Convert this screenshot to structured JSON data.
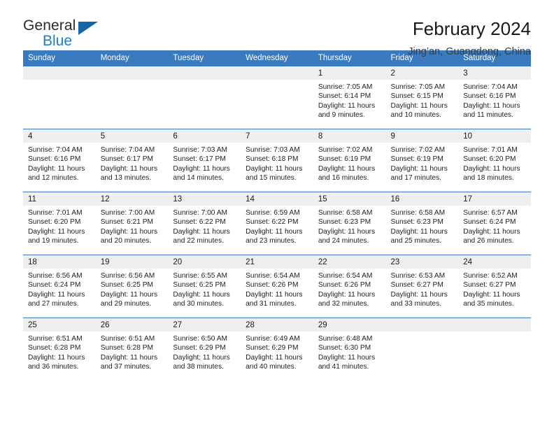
{
  "brand": {
    "name_part1": "General",
    "name_part2": "Blue",
    "triangle_color": "#1566a8",
    "blue_color": "#1d7ec6"
  },
  "header": {
    "title": "February 2024",
    "subtitle": "Jing’an, Guangdong, China",
    "header_bg": "#3a7bbf",
    "daynum_bg": "#efefef"
  },
  "weekdays": [
    "Sunday",
    "Monday",
    "Tuesday",
    "Wednesday",
    "Thursday",
    "Friday",
    "Saturday"
  ],
  "labels": {
    "sunrise": "Sunrise:",
    "sunset": "Sunset:",
    "daylight": "Daylight:"
  },
  "weeks": [
    [
      {
        "day": "",
        "sunrise": "",
        "sunset": "",
        "daylight_a": "",
        "daylight_b": ""
      },
      {
        "day": "",
        "sunrise": "",
        "sunset": "",
        "daylight_a": "",
        "daylight_b": ""
      },
      {
        "day": "",
        "sunrise": "",
        "sunset": "",
        "daylight_a": "",
        "daylight_b": ""
      },
      {
        "day": "",
        "sunrise": "",
        "sunset": "",
        "daylight_a": "",
        "daylight_b": ""
      },
      {
        "day": "1",
        "sunrise": "Sunrise: 7:05 AM",
        "sunset": "Sunset: 6:14 PM",
        "daylight_a": "Daylight: 11 hours",
        "daylight_b": "and 9 minutes."
      },
      {
        "day": "2",
        "sunrise": "Sunrise: 7:05 AM",
        "sunset": "Sunset: 6:15 PM",
        "daylight_a": "Daylight: 11 hours",
        "daylight_b": "and 10 minutes."
      },
      {
        "day": "3",
        "sunrise": "Sunrise: 7:04 AM",
        "sunset": "Sunset: 6:16 PM",
        "daylight_a": "Daylight: 11 hours",
        "daylight_b": "and 11 minutes."
      }
    ],
    [
      {
        "day": "4",
        "sunrise": "Sunrise: 7:04 AM",
        "sunset": "Sunset: 6:16 PM",
        "daylight_a": "Daylight: 11 hours",
        "daylight_b": "and 12 minutes."
      },
      {
        "day": "5",
        "sunrise": "Sunrise: 7:04 AM",
        "sunset": "Sunset: 6:17 PM",
        "daylight_a": "Daylight: 11 hours",
        "daylight_b": "and 13 minutes."
      },
      {
        "day": "6",
        "sunrise": "Sunrise: 7:03 AM",
        "sunset": "Sunset: 6:17 PM",
        "daylight_a": "Daylight: 11 hours",
        "daylight_b": "and 14 minutes."
      },
      {
        "day": "7",
        "sunrise": "Sunrise: 7:03 AM",
        "sunset": "Sunset: 6:18 PM",
        "daylight_a": "Daylight: 11 hours",
        "daylight_b": "and 15 minutes."
      },
      {
        "day": "8",
        "sunrise": "Sunrise: 7:02 AM",
        "sunset": "Sunset: 6:19 PM",
        "daylight_a": "Daylight: 11 hours",
        "daylight_b": "and 16 minutes."
      },
      {
        "day": "9",
        "sunrise": "Sunrise: 7:02 AM",
        "sunset": "Sunset: 6:19 PM",
        "daylight_a": "Daylight: 11 hours",
        "daylight_b": "and 17 minutes."
      },
      {
        "day": "10",
        "sunrise": "Sunrise: 7:01 AM",
        "sunset": "Sunset: 6:20 PM",
        "daylight_a": "Daylight: 11 hours",
        "daylight_b": "and 18 minutes."
      }
    ],
    [
      {
        "day": "11",
        "sunrise": "Sunrise: 7:01 AM",
        "sunset": "Sunset: 6:20 PM",
        "daylight_a": "Daylight: 11 hours",
        "daylight_b": "and 19 minutes."
      },
      {
        "day": "12",
        "sunrise": "Sunrise: 7:00 AM",
        "sunset": "Sunset: 6:21 PM",
        "daylight_a": "Daylight: 11 hours",
        "daylight_b": "and 20 minutes."
      },
      {
        "day": "13",
        "sunrise": "Sunrise: 7:00 AM",
        "sunset": "Sunset: 6:22 PM",
        "daylight_a": "Daylight: 11 hours",
        "daylight_b": "and 22 minutes."
      },
      {
        "day": "14",
        "sunrise": "Sunrise: 6:59 AM",
        "sunset": "Sunset: 6:22 PM",
        "daylight_a": "Daylight: 11 hours",
        "daylight_b": "and 23 minutes."
      },
      {
        "day": "15",
        "sunrise": "Sunrise: 6:58 AM",
        "sunset": "Sunset: 6:23 PM",
        "daylight_a": "Daylight: 11 hours",
        "daylight_b": "and 24 minutes."
      },
      {
        "day": "16",
        "sunrise": "Sunrise: 6:58 AM",
        "sunset": "Sunset: 6:23 PM",
        "daylight_a": "Daylight: 11 hours",
        "daylight_b": "and 25 minutes."
      },
      {
        "day": "17",
        "sunrise": "Sunrise: 6:57 AM",
        "sunset": "Sunset: 6:24 PM",
        "daylight_a": "Daylight: 11 hours",
        "daylight_b": "and 26 minutes."
      }
    ],
    [
      {
        "day": "18",
        "sunrise": "Sunrise: 6:56 AM",
        "sunset": "Sunset: 6:24 PM",
        "daylight_a": "Daylight: 11 hours",
        "daylight_b": "and 27 minutes."
      },
      {
        "day": "19",
        "sunrise": "Sunrise: 6:56 AM",
        "sunset": "Sunset: 6:25 PM",
        "daylight_a": "Daylight: 11 hours",
        "daylight_b": "and 29 minutes."
      },
      {
        "day": "20",
        "sunrise": "Sunrise: 6:55 AM",
        "sunset": "Sunset: 6:25 PM",
        "daylight_a": "Daylight: 11 hours",
        "daylight_b": "and 30 minutes."
      },
      {
        "day": "21",
        "sunrise": "Sunrise: 6:54 AM",
        "sunset": "Sunset: 6:26 PM",
        "daylight_a": "Daylight: 11 hours",
        "daylight_b": "and 31 minutes."
      },
      {
        "day": "22",
        "sunrise": "Sunrise: 6:54 AM",
        "sunset": "Sunset: 6:26 PM",
        "daylight_a": "Daylight: 11 hours",
        "daylight_b": "and 32 minutes."
      },
      {
        "day": "23",
        "sunrise": "Sunrise: 6:53 AM",
        "sunset": "Sunset: 6:27 PM",
        "daylight_a": "Daylight: 11 hours",
        "daylight_b": "and 33 minutes."
      },
      {
        "day": "24",
        "sunrise": "Sunrise: 6:52 AM",
        "sunset": "Sunset: 6:27 PM",
        "daylight_a": "Daylight: 11 hours",
        "daylight_b": "and 35 minutes."
      }
    ],
    [
      {
        "day": "25",
        "sunrise": "Sunrise: 6:51 AM",
        "sunset": "Sunset: 6:28 PM",
        "daylight_a": "Daylight: 11 hours",
        "daylight_b": "and 36 minutes."
      },
      {
        "day": "26",
        "sunrise": "Sunrise: 6:51 AM",
        "sunset": "Sunset: 6:28 PM",
        "daylight_a": "Daylight: 11 hours",
        "daylight_b": "and 37 minutes."
      },
      {
        "day": "27",
        "sunrise": "Sunrise: 6:50 AM",
        "sunset": "Sunset: 6:29 PM",
        "daylight_a": "Daylight: 11 hours",
        "daylight_b": "and 38 minutes."
      },
      {
        "day": "28",
        "sunrise": "Sunrise: 6:49 AM",
        "sunset": "Sunset: 6:29 PM",
        "daylight_a": "Daylight: 11 hours",
        "daylight_b": "and 40 minutes."
      },
      {
        "day": "29",
        "sunrise": "Sunrise: 6:48 AM",
        "sunset": "Sunset: 6:30 PM",
        "daylight_a": "Daylight: 11 hours",
        "daylight_b": "and 41 minutes."
      },
      {
        "day": "",
        "sunrise": "",
        "sunset": "",
        "daylight_a": "",
        "daylight_b": ""
      },
      {
        "day": "",
        "sunrise": "",
        "sunset": "",
        "daylight_a": "",
        "daylight_b": ""
      }
    ]
  ]
}
